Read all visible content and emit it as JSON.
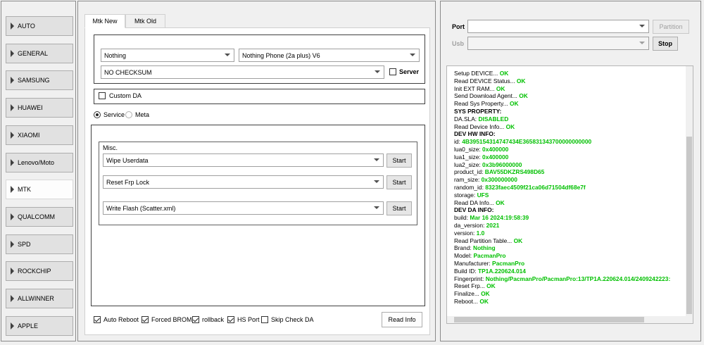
{
  "nav": {
    "items": [
      {
        "label": "AUTO"
      },
      {
        "label": "GENERAL"
      },
      {
        "label": "SAMSUNG"
      },
      {
        "label": "HUAWEI"
      },
      {
        "label": "XIAOMI"
      },
      {
        "label": "Lenovo/Moto"
      },
      {
        "label": "MTK",
        "active": true
      },
      {
        "label": "QUALCOMM"
      },
      {
        "label": "SPD"
      },
      {
        "label": "ROCKCHIP"
      },
      {
        "label": "ALLWINNER"
      },
      {
        "label": "APPLE"
      }
    ]
  },
  "tabs": {
    "mtk_new": "Mtk New",
    "mtk_old": "Mtk Old"
  },
  "device": {
    "brand": "Nothing",
    "model": "Nothing Phone (2a plus)  V6",
    "checksum": "NO CHECKSUM",
    "server_label": "Server",
    "custom_da_label": "Custom DA"
  },
  "mode": {
    "service": "Service",
    "meta": "Meta"
  },
  "misc": {
    "title": "Misc.",
    "rows": [
      {
        "value": "Wipe Userdata",
        "button": "Start"
      },
      {
        "value": "Reset Frp Lock",
        "button": "Start"
      },
      {
        "value": "Write Flash (Scatter.xml)",
        "button": "Start"
      }
    ]
  },
  "options": {
    "auto_reboot": "Auto Reboot",
    "forced_brom": "Forced BROM",
    "rollback": "rollback",
    "hs_port": "HS Port",
    "skip_check_da": "Skip Check DA",
    "read_info": "Read Info"
  },
  "connection": {
    "port_label": "Port",
    "usb_label": "Usb",
    "partition_button": "Partition",
    "stop_button": "Stop"
  },
  "log": [
    {
      "t": "Setup DEVICE... ",
      "v": "OK"
    },
    {
      "t": "Read DEVICE Status... ",
      "v": "OK"
    },
    {
      "t": "Init EXT RAM... ",
      "v": "OK"
    },
    {
      "t": "Send Download Agent... ",
      "v": "OK"
    },
    {
      "t": "Read Sys Property... ",
      "v": "OK"
    },
    {
      "t": "SYS PROPERTY:",
      "v": "",
      "b": true
    },
    {
      "t": "DA.SLA: ",
      "v": "DISABLED"
    },
    {
      "t": "Read Device Info... ",
      "v": "OK"
    },
    {
      "t": "DEV HW INFO:",
      "v": "",
      "b": true
    },
    {
      "t": "id: ",
      "v": "4B395154314747434E365831343700000000000"
    },
    {
      "t": "lua0_size: ",
      "v": "0x400000"
    },
    {
      "t": "lua1_size: ",
      "v": "0x400000"
    },
    {
      "t": "lua2_size: ",
      "v": "0x3b96000000"
    },
    {
      "t": "product_id: ",
      "v": "BAV55DKZRS498D65"
    },
    {
      "t": "ram_size: ",
      "v": "0x300000000"
    },
    {
      "t": "random_id: ",
      "v": "8323faec4509f21ca06d71504df68e7f"
    },
    {
      "t": "storage: ",
      "v": "UFS"
    },
    {
      "t": "Read DA Info... ",
      "v": "OK"
    },
    {
      "t": "DEV DA INFO:",
      "v": "",
      "b": true
    },
    {
      "t": "build: ",
      "v": "Mar 16 2024:19:58:39"
    },
    {
      "t": "da_version: ",
      "v": "2021"
    },
    {
      "t": "version: ",
      "v": "1.0"
    },
    {
      "t": "Read Partition Table... ",
      "v": "OK"
    },
    {
      "t": " Brand: ",
      "v": "Nothing"
    },
    {
      "t": " Model: ",
      "v": "PacmanPro"
    },
    {
      "t": " Manufacturer: ",
      "v": "PacmanPro"
    },
    {
      "t": "Build ID: ",
      "v": "TP1A.220624.014"
    },
    {
      "t": "Fingerprint: ",
      "v": "Nothing/PacmanPro/PacmanPro:13/TP1A.220624.014/2409242223:"
    },
    {
      "t": "Reset Frp... ",
      "v": "OK"
    },
    {
      "t": "Finalize... ",
      "v": "OK"
    },
    {
      "t": "Reboot... ",
      "v": "OK"
    }
  ]
}
